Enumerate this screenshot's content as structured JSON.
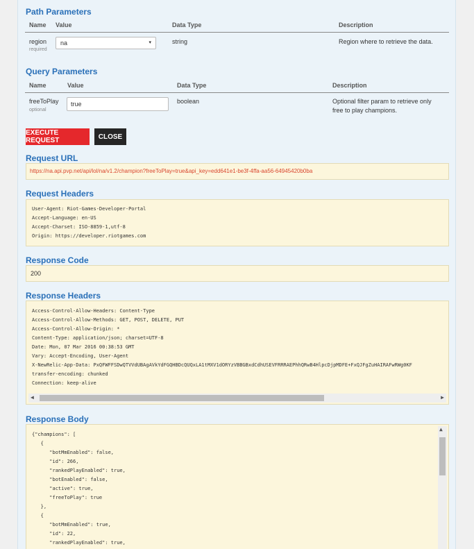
{
  "path_params": {
    "title": "Path Parameters",
    "headers": [
      "Name",
      "Value",
      "Data Type",
      "Description"
    ],
    "row": {
      "name": "region",
      "required": "required",
      "value": "na",
      "type": "string",
      "description": "Region where to retrieve the data."
    }
  },
  "query_params": {
    "title": "Query Parameters",
    "headers": [
      "Name",
      "Value",
      "Data Type",
      "Description"
    ],
    "row": {
      "name": "freeToPlay",
      "optional": "optional",
      "value": "true",
      "type": "boolean",
      "description_1": "Optional filter param to retrieve only",
      "description_2": "free to play champions."
    }
  },
  "buttons": {
    "execute": "Execute Request",
    "close": "Close"
  },
  "request_url": {
    "title": "Request URL",
    "value": "https://na.api.pvp.net/api/lol/na/v1.2/champion?freeToPlay=true&api_key=edd641e1-be3f-4ffa-aa56-64945420b0ba"
  },
  "request_headers": {
    "title": "Request Headers",
    "lines": [
      "User-Agent: Riot-Games-Developer-Portal",
      "Accept-Language: en-US",
      "Accept-Charset: ISO-8859-1,utf-8",
      "Origin: https://developer.riotgames.com"
    ]
  },
  "response_code": {
    "title": "Response Code",
    "value": "200"
  },
  "response_headers": {
    "title": "Response Headers",
    "lines": [
      "Access-Control-Allow-Headers: Content-Type",
      "Access-Control-Allow-Methods: GET, POST, DELETE, PUT",
      "Access-Control-Allow-Origin: *",
      "Content-Type: application/json; charset=UTF-8",
      "Date: Mon, 07 Mar 2016 00:38:53 GMT",
      "Vary: Accept-Encoding, User-Agent",
      "X-NewRelic-App-Data: PxQFWFFSDwQTVVdUBAgAVkYdFGQHBDcQUQxLA1tMXV1dORYzVBBGBxdCdhUSEVFRRRAEPhhQRwB4HlpcDjpMDFE+FxQJFgZuHAIRAFwRWg0KF",
      "transfer-encoding: chunked",
      "Connection: keep-alive"
    ]
  },
  "response_body": {
    "title": "Response Body",
    "lines": [
      "{\"champions\": [",
      "   {",
      "      \"botMmEnabled\": false,",
      "      \"id\": 266,",
      "      \"rankedPlayEnabled\": true,",
      "      \"botEnabled\": false,",
      "      \"active\": true,",
      "      \"freeToPlay\": true",
      "   },",
      "   {",
      "      \"botMmEnabled\": true,",
      "      \"id\": 22,",
      "      \"rankedPlayEnabled\": true,"
    ]
  }
}
